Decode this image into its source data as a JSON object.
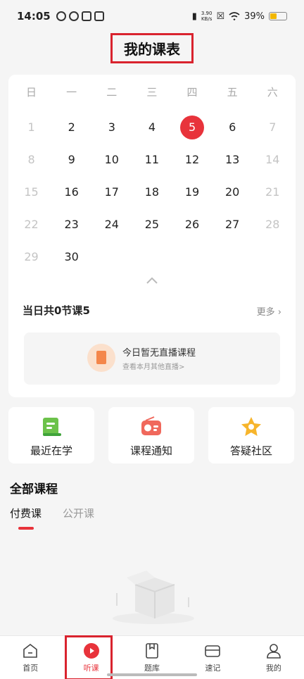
{
  "status_bar": {
    "time": "14:05",
    "speed_value": "3.90",
    "speed_unit": "KB/s",
    "battery": "39%"
  },
  "header": {
    "title": "我的课表"
  },
  "calendar": {
    "weekdays": [
      "日",
      "一",
      "二",
      "三",
      "四",
      "五",
      "六"
    ],
    "weeks": [
      [
        "1",
        "2",
        "3",
        "4",
        "5",
        "6",
        "7"
      ],
      [
        "8",
        "9",
        "10",
        "11",
        "12",
        "13",
        "14"
      ],
      [
        "15",
        "16",
        "17",
        "18",
        "19",
        "20",
        "21"
      ],
      [
        "22",
        "23",
        "24",
        "25",
        "26",
        "27",
        "28"
      ],
      [
        "29",
        "30",
        "",
        "",
        "",
        "",
        ""
      ]
    ],
    "today": "5",
    "summary": "当日共0节课5",
    "more_label": "更多",
    "live_title": "今日暂无直播课程",
    "live_subtitle": "查看本月其他直播>"
  },
  "shortcuts": [
    {
      "label": "最近在学",
      "icon": "book-green-icon"
    },
    {
      "label": "课程通知",
      "icon": "radio-icon"
    },
    {
      "label": "答疑社区",
      "icon": "star-icon"
    }
  ],
  "courses": {
    "title": "全部课程",
    "tabs": [
      "付费课",
      "公开课"
    ],
    "active_tab": "付费课"
  },
  "bottom_nav": [
    {
      "label": "首页",
      "icon": "home-icon"
    },
    {
      "label": "听课",
      "icon": "play-icon"
    },
    {
      "label": "题库",
      "icon": "question-bank-icon"
    },
    {
      "label": "速记",
      "icon": "card-icon"
    },
    {
      "label": "我的",
      "icon": "profile-icon"
    }
  ],
  "colors": {
    "accent": "#e8333b",
    "highlight_box": "#d9232e",
    "battery": "#f2b700"
  }
}
